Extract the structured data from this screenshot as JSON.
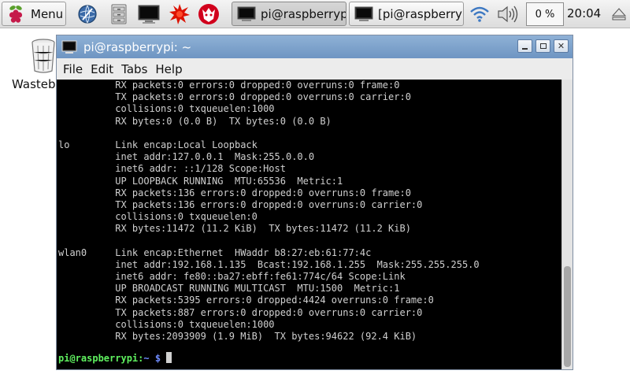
{
  "taskbar": {
    "menu_label": "Menu",
    "launchers": [
      "browser-icon",
      "file-manager-icon",
      "terminal-icon",
      "wolfram-icon",
      "mathematica-icon"
    ],
    "tasks": [
      {
        "label": "pi@raspberryp",
        "active": true
      },
      {
        "label": "[pi@raspberry",
        "active": false
      }
    ],
    "tray": {
      "cpu_label": "0 %",
      "clock": "20:04"
    }
  },
  "desktop": {
    "wastebasket_label": "Wasteba"
  },
  "window": {
    "title": "pi@raspberrypi: ~",
    "menu": [
      "File",
      "Edit",
      "Tabs",
      "Help"
    ],
    "terminal": {
      "lines": [
        "          RX packets:0 errors:0 dropped:0 overruns:0 frame:0",
        "          TX packets:0 errors:0 dropped:0 overruns:0 carrier:0",
        "          collisions:0 txqueuelen:1000",
        "          RX bytes:0 (0.0 B)  TX bytes:0 (0.0 B)",
        "",
        "lo        Link encap:Local Loopback",
        "          inet addr:127.0.0.1  Mask:255.0.0.0",
        "          inet6 addr: ::1/128 Scope:Host",
        "          UP LOOPBACK RUNNING  MTU:65536  Metric:1",
        "          RX packets:136 errors:0 dropped:0 overruns:0 frame:0",
        "          TX packets:136 errors:0 dropped:0 overruns:0 carrier:0",
        "          collisions:0 txqueuelen:0",
        "          RX bytes:11472 (11.2 KiB)  TX bytes:11472 (11.2 KiB)",
        "",
        "wlan0     Link encap:Ethernet  HWaddr b8:27:eb:61:77:4c",
        "          inet addr:192.168.1.135  Bcast:192.168.1.255  Mask:255.255.255.0",
        "          inet6 addr: fe80::ba27:ebff:fe61:774c/64 Scope:Link",
        "          UP BROADCAST RUNNING MULTICAST  MTU:1500  Metric:1",
        "          RX packets:5395 errors:0 dropped:4424 overruns:0 frame:0",
        "          TX packets:887 errors:0 dropped:0 overruns:0 carrier:0",
        "          collisions:0 txqueuelen:1000",
        "          RX bytes:2093909 (1.9 MiB)  TX bytes:94622 (92.4 KiB)"
      ],
      "prompt_user": "pi@raspberrypi",
      "prompt_sep": ":",
      "prompt_path": "~",
      "prompt_symbol": " $ "
    }
  },
  "colors": {
    "titlebar": "#7aa0cc",
    "terminal_bg": "#000000",
    "terminal_fg": "#d0d0d0",
    "prompt_user": "#5ff05f",
    "prompt_path": "#6f8cff"
  }
}
